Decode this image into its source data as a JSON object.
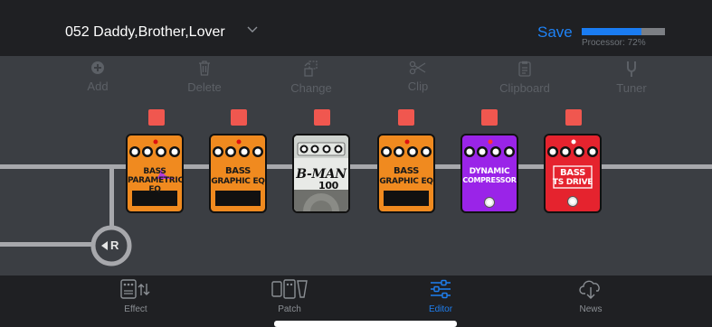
{
  "header": {
    "patch_name": "052 Daddy,Brother,Lover",
    "save_label": "Save",
    "processor_label": "Processor: 72%",
    "processor_load": 0.72,
    "accent_color": "#1e82f5"
  },
  "toolbar": {
    "items": [
      {
        "label": "Add",
        "icon": "plus-circle-icon"
      },
      {
        "label": "Delete",
        "icon": "trash-icon"
      },
      {
        "label": "Change",
        "icon": "swap-icon"
      },
      {
        "label": "Clip",
        "icon": "scissors-icon"
      },
      {
        "label": "Clipboard",
        "icon": "clipboard-icon"
      },
      {
        "label": "Tuner",
        "icon": "tuning-fork-icon"
      }
    ]
  },
  "chain": {
    "return_label": "R",
    "pedals": [
      {
        "line1": "BASS",
        "line2": "PARAMETRIC EQ",
        "color": "#f08a1f",
        "type": "parametric-eq"
      },
      {
        "line1": "BASS",
        "line2": "GRAPHIC EQ",
        "color": "#f08a1f",
        "type": "graphic-eq"
      },
      {
        "line1": "B-MAN",
        "line2": "100",
        "color": "#e8eae7",
        "type": "amp"
      },
      {
        "line1": "BASS",
        "line2": "GRAPHIC EQ",
        "color": "#f08a1f",
        "type": "graphic-eq"
      },
      {
        "line1": "DYNAMIC",
        "line2": "COMPRESSOR",
        "color": "#9a24e8",
        "type": "compressor"
      },
      {
        "line1": "BASS",
        "line2": "TS DRIVE",
        "color": "#e5232e",
        "type": "drive"
      }
    ]
  },
  "bottom_nav": {
    "items": [
      {
        "label": "Effect",
        "icon": "effect-icon",
        "active": false
      },
      {
        "label": "Patch",
        "icon": "patch-icon",
        "active": false
      },
      {
        "label": "Editor",
        "icon": "sliders-icon",
        "active": true
      },
      {
        "label": "News",
        "icon": "cloud-download-icon",
        "active": false
      }
    ]
  }
}
